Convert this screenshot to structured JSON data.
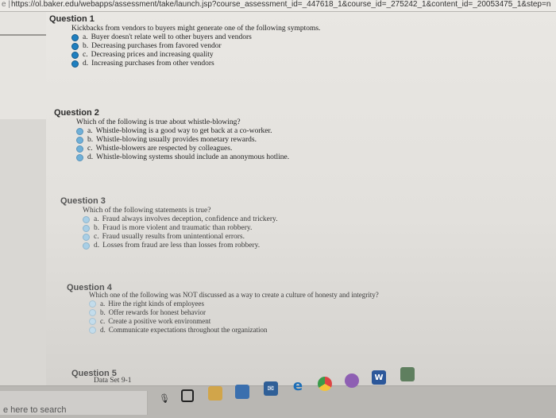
{
  "browser": {
    "url": "https://ol.baker.edu/webapps/assessment/take/launch.jsp?course_assessment_id=_447618_1&course_id=_275242_1&content_id=_20053475_1&step=n"
  },
  "questions": [
    {
      "title": "Question 1",
      "stem": "Kickbacks from vendors to buyers might generate one of the following symptoms.",
      "options": [
        {
          "key": "a.",
          "text": "Buyer doesn't relate well to other buyers and vendors"
        },
        {
          "key": "b.",
          "text": "Decreasing purchases from favored vendor"
        },
        {
          "key": "c.",
          "text": "Decreasing prices and increasing quality"
        },
        {
          "key": "d.",
          "text": "Increasing purchases from other vendors"
        }
      ]
    },
    {
      "title": "Question 2",
      "stem": "Which of the following is true about whistle-blowing?",
      "options": [
        {
          "key": "a.",
          "text": "Whistle-blowing is a good way to get back at a co-worker."
        },
        {
          "key": "b.",
          "text": "Whistle-blowing usually provides monetary rewards."
        },
        {
          "key": "c.",
          "text": "Whistle-blowers are respected by colleagues."
        },
        {
          "key": "d.",
          "text": "Whistle-blowing systems should include an anonymous hotline."
        }
      ]
    },
    {
      "title": "Question 3",
      "stem": "Which of the following statements is true?",
      "options": [
        {
          "key": "a.",
          "text": "Fraud always involves deception, confidence and trickery."
        },
        {
          "key": "b.",
          "text": "Fraud is more violent and traumatic than robbery."
        },
        {
          "key": "c.",
          "text": "Fraud usually results from unintentional errors."
        },
        {
          "key": "d.",
          "text": "Losses from fraud are less than losses from robbery."
        }
      ]
    },
    {
      "title": "Question 4",
      "stem": "Which one of the following was NOT discussed as a way to create a culture of honesty and integrity?",
      "options": [
        {
          "key": "a.",
          "text": "Hire the right kinds of employees"
        },
        {
          "key": "b.",
          "text": "Offer rewards for honest behavior"
        },
        {
          "key": "c.",
          "text": "Create a positive work environment"
        },
        {
          "key": "d.",
          "text": "Communicate expectations throughout the organization"
        }
      ]
    },
    {
      "title": "Question 5",
      "stem": "Data Set 9-1"
    }
  ],
  "taskbar": {
    "search_text": "e here to search",
    "apps": [
      "microphone-icon",
      "task-view-icon",
      "file-explorer-icon",
      "store-icon",
      "mail-icon",
      "edge-icon",
      "chrome-icon",
      "word-icon",
      "app-icon"
    ]
  }
}
